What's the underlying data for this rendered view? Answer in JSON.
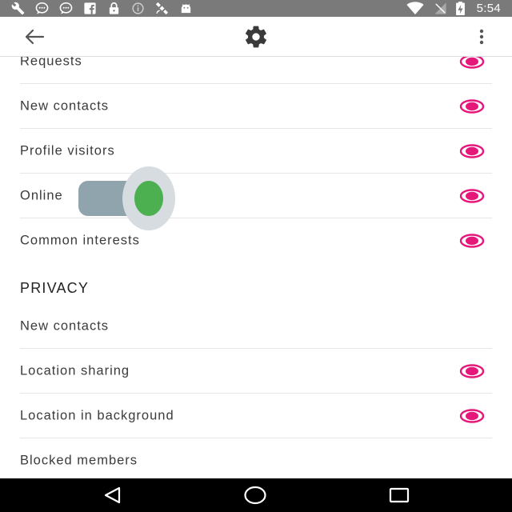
{
  "status_bar": {
    "time": "5:54",
    "left_icons": [
      "wrench-icon",
      "chat-bubble-icon",
      "chat-bubble-icon",
      "facebook-icon",
      "lock-icon",
      "info-icon",
      "satellite-icon",
      "android-icon"
    ],
    "right_icons": [
      "wifi-icon",
      "no-signal-icon",
      "battery-charging-icon"
    ]
  },
  "app_bar": {
    "back_icon": "arrow-left-icon",
    "center_icon": "gear-icon",
    "menu_icon": "more-vertical-icon"
  },
  "notifications": {
    "items": [
      {
        "label": "Requests",
        "enabled": true
      },
      {
        "label": "New contacts",
        "enabled": true
      },
      {
        "label": "Profile visitors",
        "enabled": true
      },
      {
        "label": "Online",
        "enabled": true
      },
      {
        "label": "Common interests",
        "enabled": true
      }
    ]
  },
  "privacy": {
    "title": "PRIVACY",
    "items": [
      {
        "label": "New contacts",
        "enabled": false
      },
      {
        "label": "Location sharing",
        "enabled": true
      },
      {
        "label": "Location in background",
        "enabled": true
      },
      {
        "label": "Blocked members",
        "enabled": false
      }
    ]
  },
  "toggle": {
    "state": "on"
  },
  "colors": {
    "status_bar": "#7a7a7a",
    "accent_pink": "#e6177a",
    "toggle_on": "#4caf50",
    "toggle_track": "#8fa4ad",
    "nav_bar": "#000000"
  },
  "nav_bar": [
    "back-triangle-icon",
    "home-circle-icon",
    "recents-square-icon"
  ]
}
